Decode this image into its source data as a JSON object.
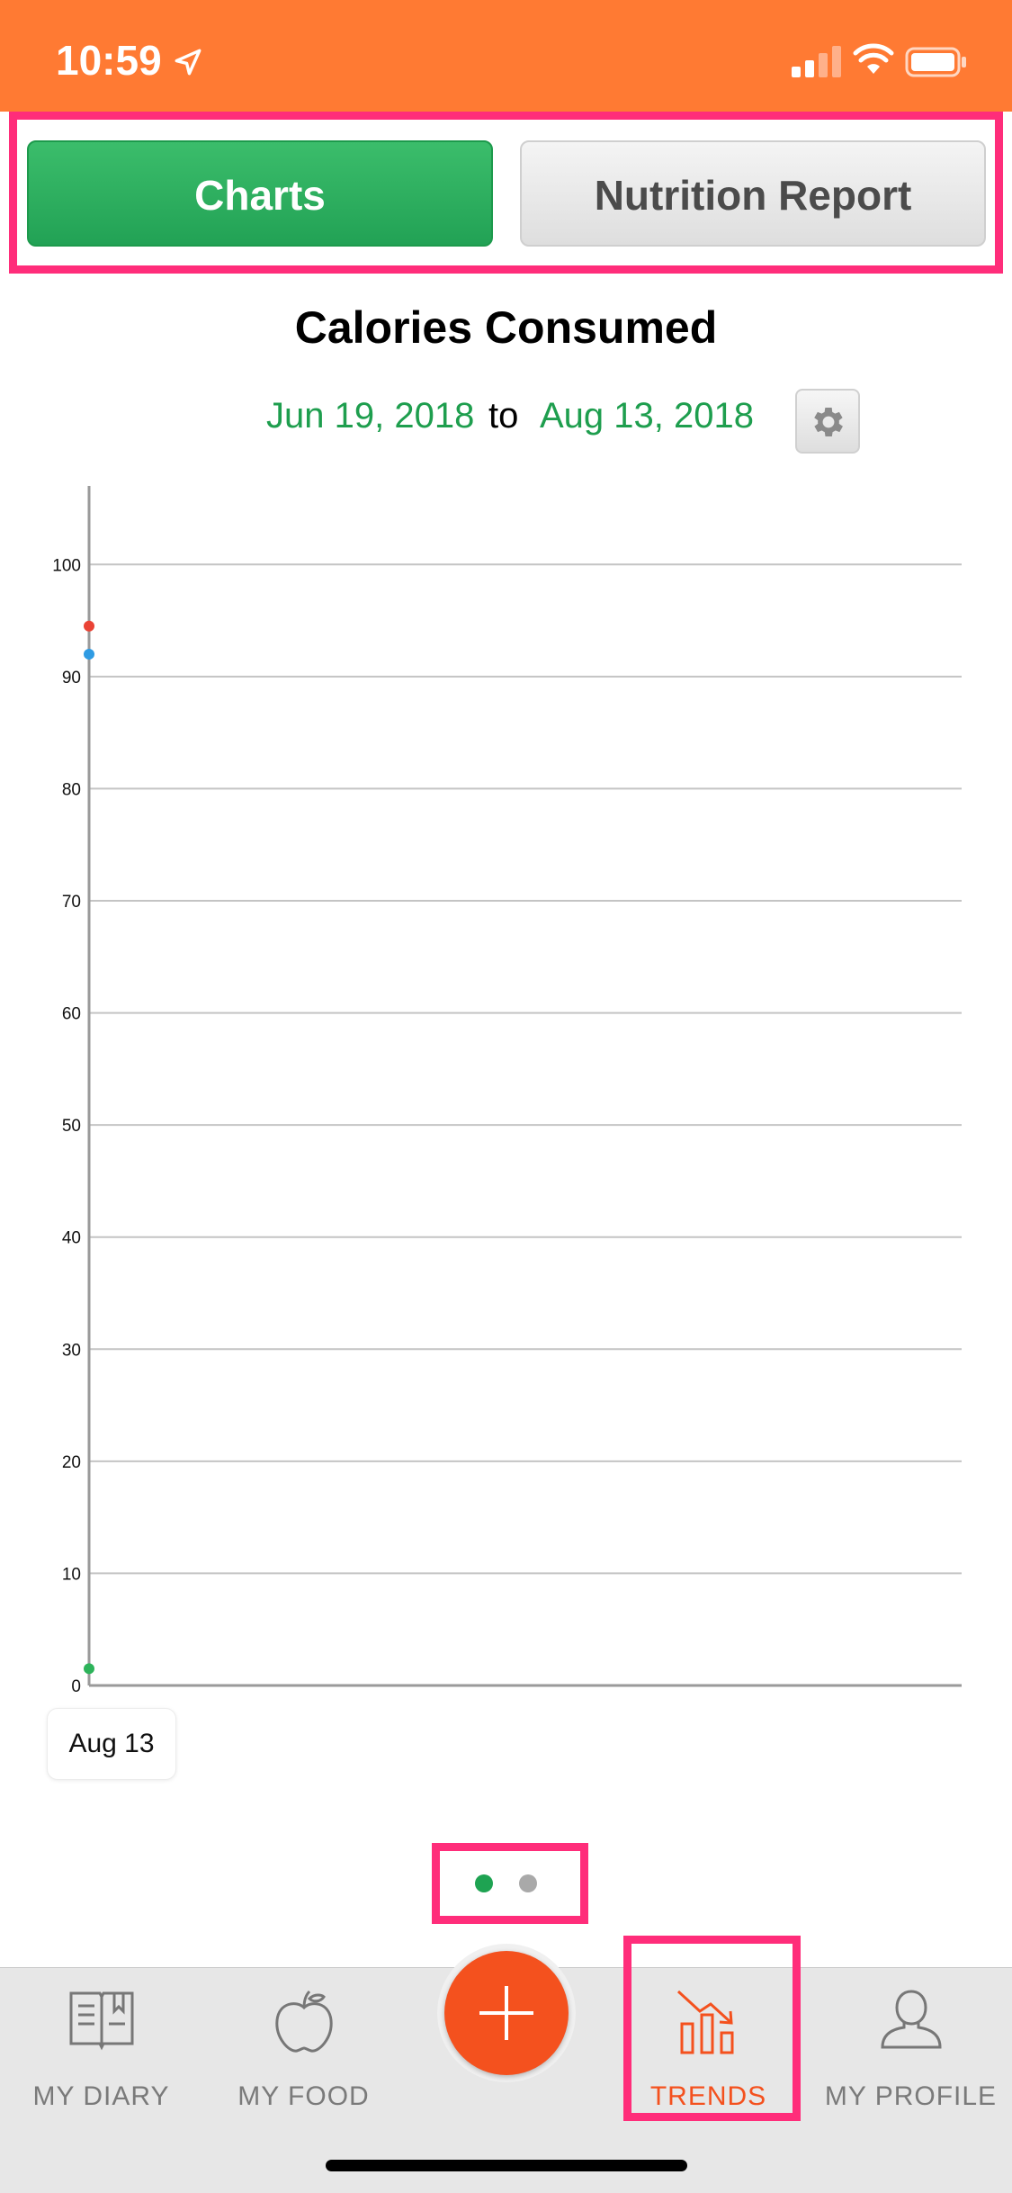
{
  "status_bar": {
    "time": "10:59"
  },
  "segmented": {
    "charts_label": "Charts",
    "report_label": "Nutrition Report",
    "selected": "Charts"
  },
  "chart_header": {
    "title": "Calories Consumed",
    "start_date": "Jun 19, 2018",
    "connector": "to",
    "end_date": "Aug 13, 2018"
  },
  "chart_data": {
    "type": "scatter",
    "title": "Calories Consumed",
    "xlabel": "",
    "ylabel": "",
    "x_tick_labels": [
      "Aug 13"
    ],
    "y_ticks": [
      0,
      10,
      20,
      30,
      40,
      50,
      60,
      70,
      80,
      90,
      100
    ],
    "ylim": [
      0,
      105
    ],
    "grid": true,
    "series": [
      {
        "color": "#ea4335",
        "points": [
          {
            "x": "Aug 13",
            "y": 94.5
          }
        ]
      },
      {
        "color": "#2f9be3",
        "points": [
          {
            "x": "Aug 13",
            "y": 92
          }
        ]
      },
      {
        "color": "#2db35a",
        "points": [
          {
            "x": "Aug 13",
            "y": 1.5
          }
        ]
      }
    ]
  },
  "pager": {
    "active_color": "#1ea352",
    "inactive_color": "#a9a9a9",
    "pages": 2,
    "current": 1
  },
  "tab_bar": {
    "items": [
      {
        "label": "MY DIARY",
        "icon": "diary-book-icon"
      },
      {
        "label": "MY FOOD",
        "icon": "apple-icon"
      },
      {
        "label": "TRENDS",
        "icon": "trends-chart-icon",
        "active": true
      },
      {
        "label": "MY PROFILE",
        "icon": "profile-person-icon"
      }
    ],
    "add_button_icon": "plus-icon",
    "active_color": "#f4511e"
  },
  "colors": {
    "status_bar": "#ff7a33",
    "accent_green": "#1e9e4e",
    "highlight": "#ff2d7a"
  }
}
